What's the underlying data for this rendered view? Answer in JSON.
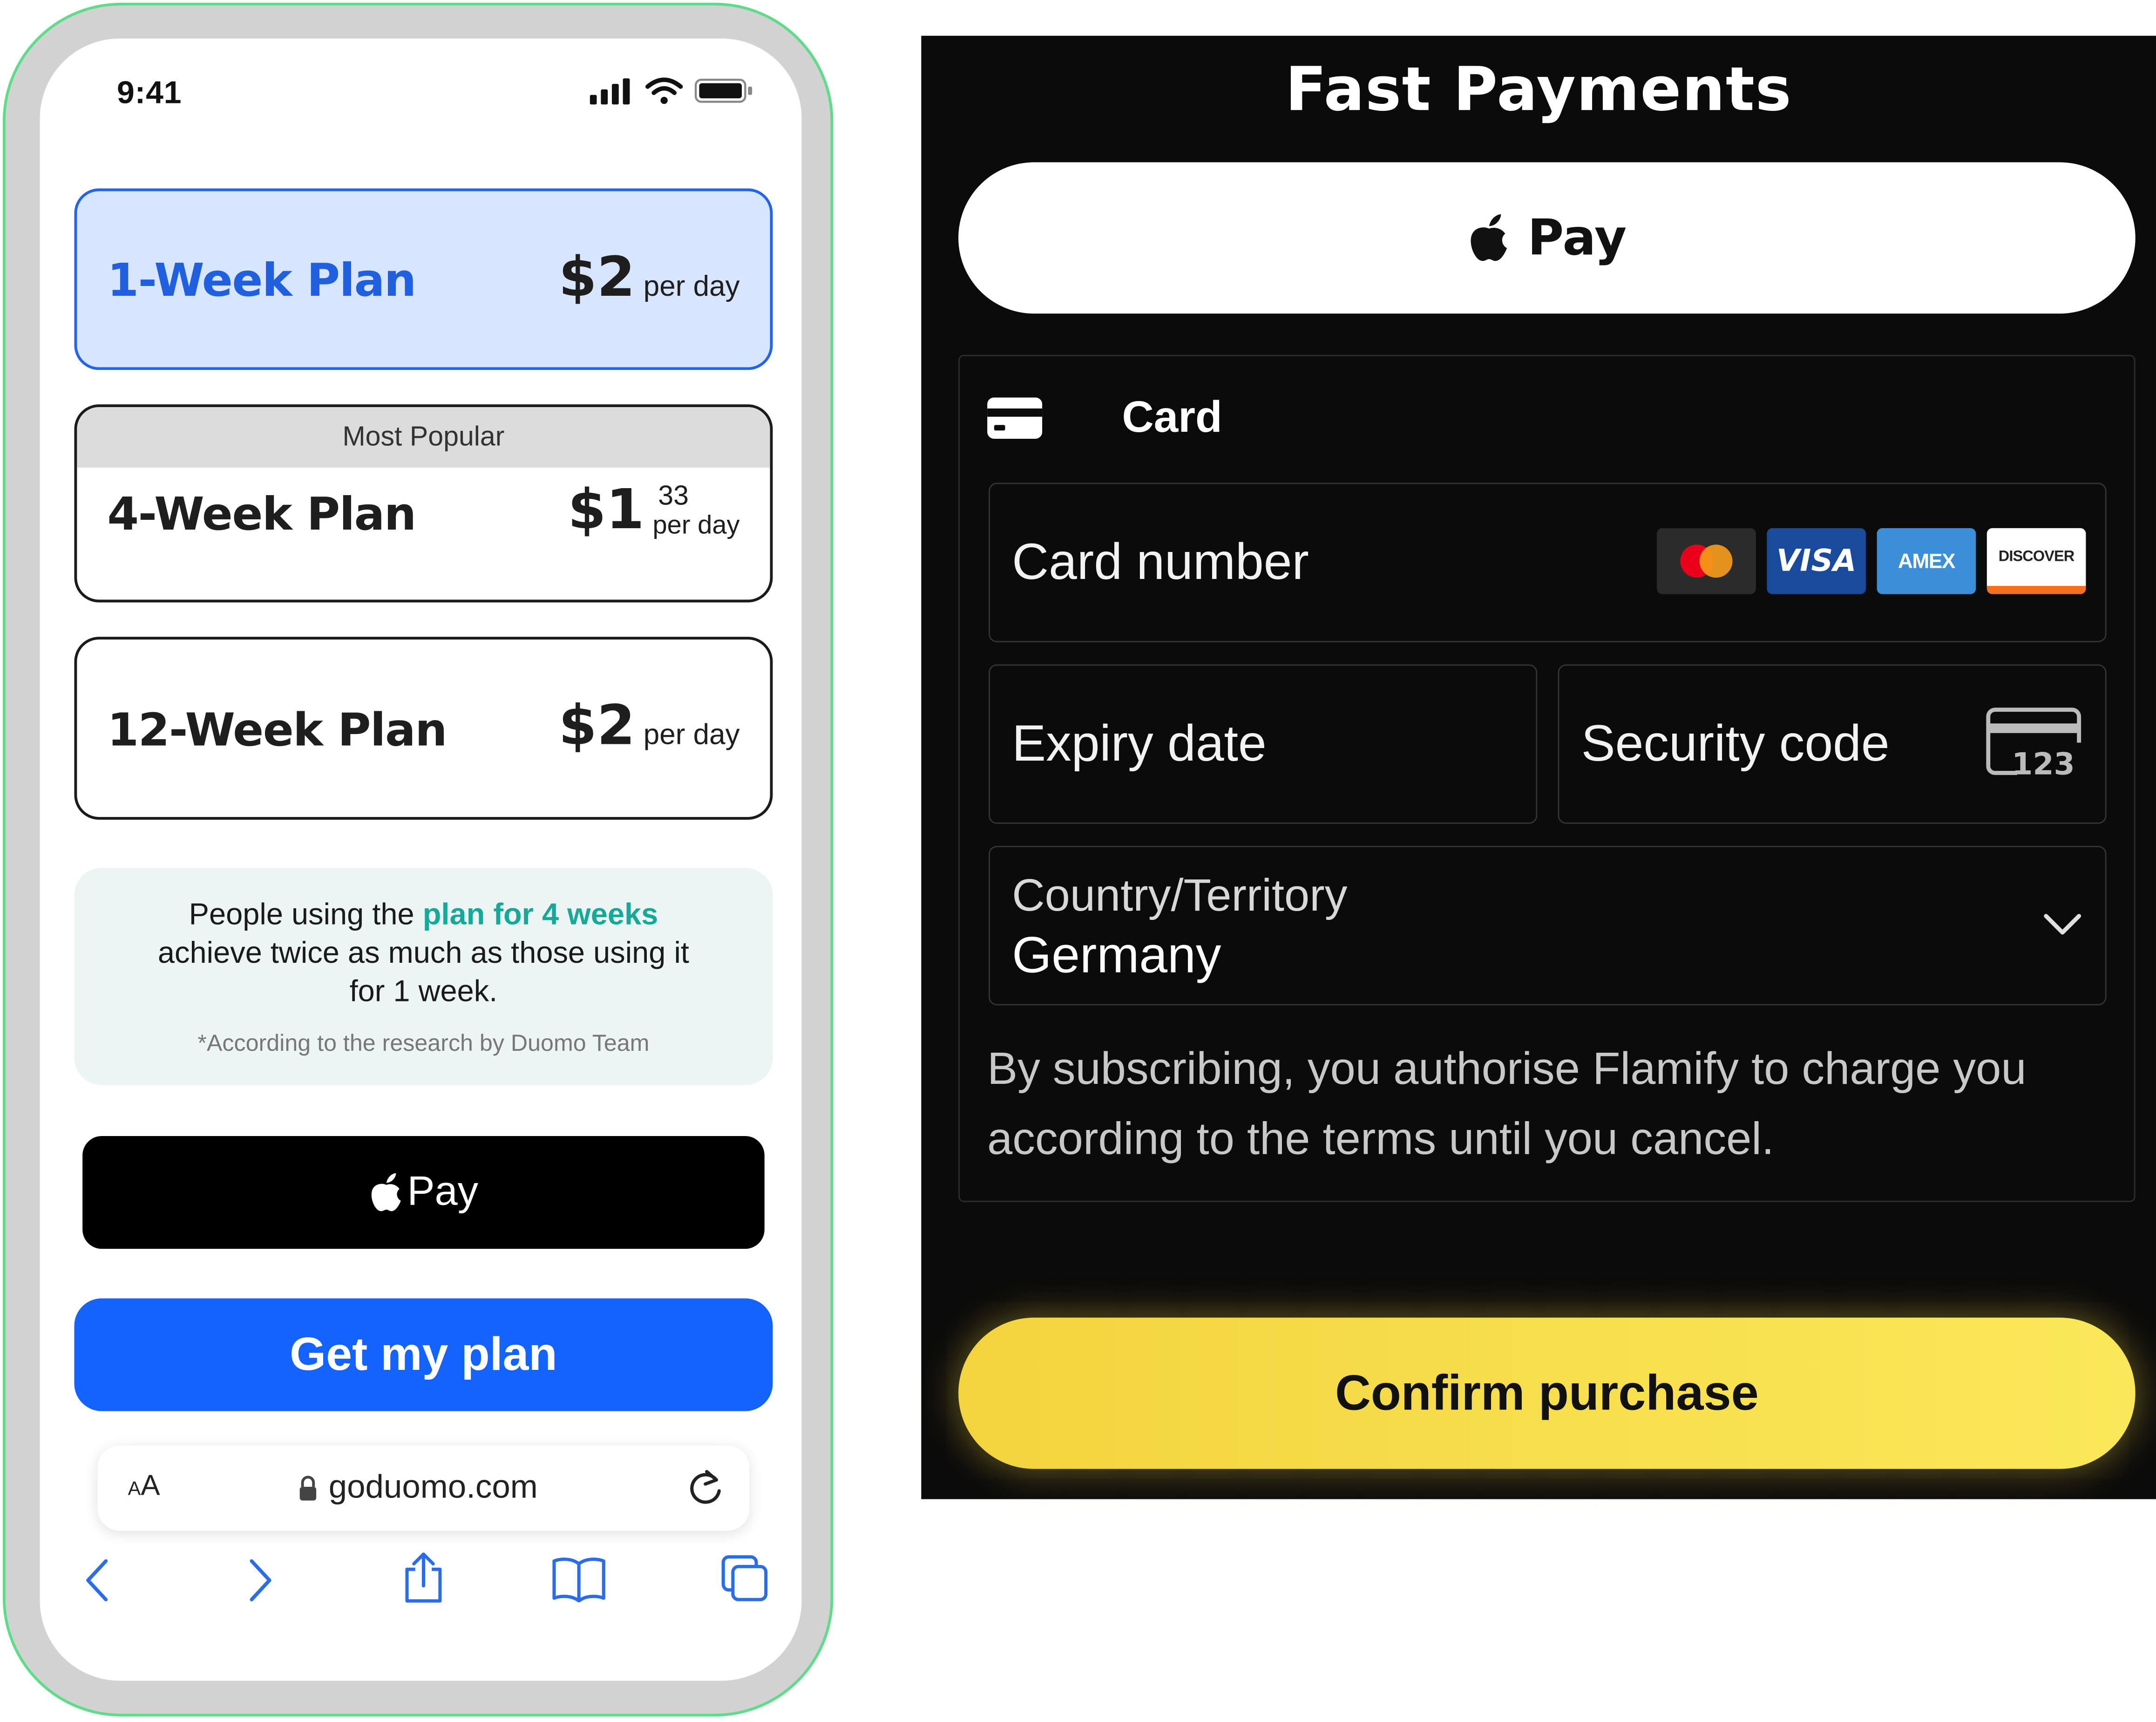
{
  "phone": {
    "status": {
      "time": "9:41"
    },
    "plans": [
      {
        "name": "1-Week Plan",
        "price": "$2",
        "unit": "per day",
        "selected": true
      },
      {
        "ribbon": "Most Popular",
        "name": "4-Week Plan",
        "price": "$1",
        "cents": "33",
        "unit": "per day"
      },
      {
        "name": "12-Week Plan",
        "price": "$2",
        "unit": "per day"
      }
    ],
    "info": {
      "line1_pre": "People using the ",
      "line1_highlight": "plan for 4 weeks",
      "line2": "achieve twice as much as those using it",
      "line3": "for 1 week.",
      "note": "*According to the research by Duomo Team"
    },
    "apple_pay_label": "Pay",
    "cta_label": "Get my plan",
    "browser": {
      "aa_small": "A",
      "aa_big": "A",
      "url": "goduomo.com"
    },
    "icons": [
      "signal-icon",
      "wifi-icon",
      "battery-icon",
      "lock-icon",
      "reload-icon",
      "back-icon",
      "forward-icon",
      "share-icon",
      "bookmarks-icon",
      "tabs-icon"
    ]
  },
  "payment": {
    "title": "Fast Payments",
    "apple_pay_label": "Pay",
    "card": {
      "header": "Card",
      "number_placeholder": "Card number",
      "brands": [
        "VISA",
        "AMEX",
        "DISCOVER"
      ],
      "expiry_placeholder": "Expiry date",
      "security_placeholder": "Security code",
      "cvc_hint": "123",
      "country_label": "Country/Territory",
      "country_value": "Germany"
    },
    "legal": "By subscribing, you authorise Flamify to charge you according to the terms until you cancel.",
    "confirm_label": "Confirm purchase",
    "colors": {
      "accent_yellow": "#F6DB45",
      "cta_blue": "#1563FF",
      "selected_plan_bg": "#D7E5FF",
      "highlight_teal": "#16A99A"
    }
  }
}
